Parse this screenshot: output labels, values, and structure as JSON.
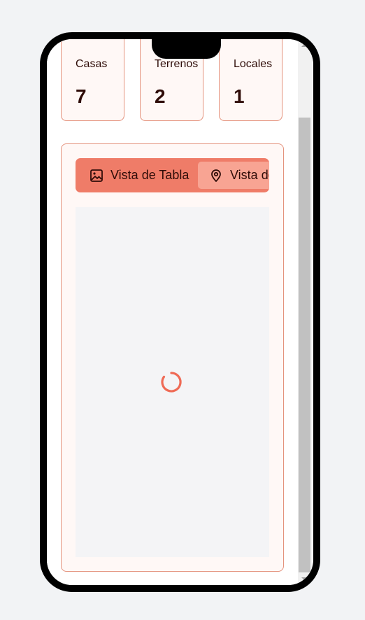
{
  "stats": [
    {
      "label": "Casas",
      "value": "7"
    },
    {
      "label": "Terrenos",
      "value": "2"
    },
    {
      "label": "Locales",
      "value": "1"
    }
  ],
  "tabs": {
    "table_label": "Vista de Tabla",
    "map_label": "Vista de Mapa"
  },
  "map": {
    "loading": true
  },
  "colors": {
    "accent": "#ef7c68",
    "accent_light": "#f8a493",
    "card_border": "#e4927c",
    "card_bg": "#fff8f6",
    "text_dark": "#2f0c08",
    "spinner": "#ef6a55"
  },
  "icons": {
    "table_tab": "image-icon",
    "map_tab": "map-pin-icon",
    "loading": "spinner-icon"
  }
}
